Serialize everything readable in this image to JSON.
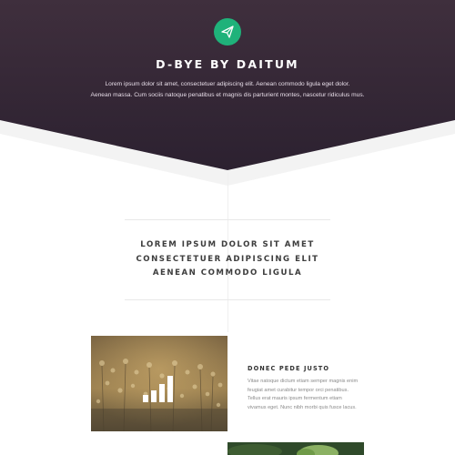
{
  "hero": {
    "title": "D-BYE BY DAITUM",
    "desc_lines": [
      "Lorem ipsum dolor sit amet, consectetuer adipiscing elit. Aenean commodo ligula eget dolor.",
      "Aenean massa. Cum sociis natoque penatibus et magnis dis parturient montes, nascetur ridiculus mus."
    ],
    "logo_icon": "paper-plane-icon"
  },
  "intro": {
    "lines": [
      "LOREM IPSUM DOLOR SIT AMET",
      "CONSECTETUER ADIPISCING ELIT",
      "AENEAN COMMODO LIGULA"
    ]
  },
  "feature": {
    "title": "DONEC PEDE JUSTO",
    "text_lines": [
      "Vitae natoque dictum etiam semper magnis enim",
      "feugiat amet curabitur tempor orci penatibus.",
      "Tellus erat mauris ipsum fermentum etiam",
      "vivamus eget. Nunc nibh morbi quis fusce lacus."
    ],
    "image_icon": "bar-chart-icon"
  },
  "colors": {
    "hero_top": "#3e2d3b",
    "hero_bottom": "#2d2230",
    "accent": "#1fb27a",
    "heading": "#3d3d3d",
    "body_text": "#8a8a8a"
  }
}
